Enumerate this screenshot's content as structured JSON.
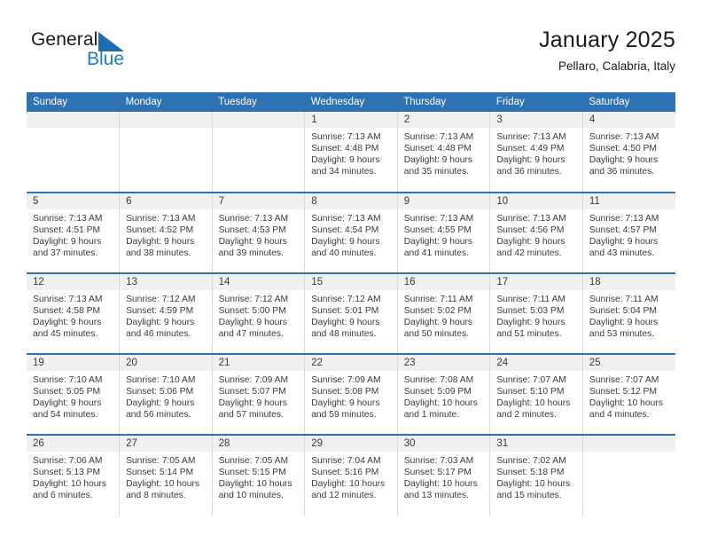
{
  "brand": {
    "name_part1": "General",
    "name_part2": "Blue",
    "logo_icon": "triangle-icon",
    "accent_color": "#1f7bc4",
    "header_color": "#2f72b4"
  },
  "header": {
    "title": "January 2025",
    "location": "Pellaro, Calabria, Italy"
  },
  "weekday_headers": [
    "Sunday",
    "Monday",
    "Tuesday",
    "Wednesday",
    "Thursday",
    "Friday",
    "Saturday"
  ],
  "weeks": [
    [
      {
        "day": "",
        "blank": true
      },
      {
        "day": "",
        "blank": true
      },
      {
        "day": "",
        "blank": true
      },
      {
        "day": "1",
        "sunrise": "Sunrise: 7:13 AM",
        "sunset": "Sunset: 4:48 PM",
        "daylight_line1": "Daylight: 9 hours",
        "daylight_line2": "and 34 minutes."
      },
      {
        "day": "2",
        "sunrise": "Sunrise: 7:13 AM",
        "sunset": "Sunset: 4:48 PM",
        "daylight_line1": "Daylight: 9 hours",
        "daylight_line2": "and 35 minutes."
      },
      {
        "day": "3",
        "sunrise": "Sunrise: 7:13 AM",
        "sunset": "Sunset: 4:49 PM",
        "daylight_line1": "Daylight: 9 hours",
        "daylight_line2": "and 36 minutes."
      },
      {
        "day": "4",
        "sunrise": "Sunrise: 7:13 AM",
        "sunset": "Sunset: 4:50 PM",
        "daylight_line1": "Daylight: 9 hours",
        "daylight_line2": "and 36 minutes."
      }
    ],
    [
      {
        "day": "5",
        "sunrise": "Sunrise: 7:13 AM",
        "sunset": "Sunset: 4:51 PM",
        "daylight_line1": "Daylight: 9 hours",
        "daylight_line2": "and 37 minutes."
      },
      {
        "day": "6",
        "sunrise": "Sunrise: 7:13 AM",
        "sunset": "Sunset: 4:52 PM",
        "daylight_line1": "Daylight: 9 hours",
        "daylight_line2": "and 38 minutes."
      },
      {
        "day": "7",
        "sunrise": "Sunrise: 7:13 AM",
        "sunset": "Sunset: 4:53 PM",
        "daylight_line1": "Daylight: 9 hours",
        "daylight_line2": "and 39 minutes."
      },
      {
        "day": "8",
        "sunrise": "Sunrise: 7:13 AM",
        "sunset": "Sunset: 4:54 PM",
        "daylight_line1": "Daylight: 9 hours",
        "daylight_line2": "and 40 minutes."
      },
      {
        "day": "9",
        "sunrise": "Sunrise: 7:13 AM",
        "sunset": "Sunset: 4:55 PM",
        "daylight_line1": "Daylight: 9 hours",
        "daylight_line2": "and 41 minutes."
      },
      {
        "day": "10",
        "sunrise": "Sunrise: 7:13 AM",
        "sunset": "Sunset: 4:56 PM",
        "daylight_line1": "Daylight: 9 hours",
        "daylight_line2": "and 42 minutes."
      },
      {
        "day": "11",
        "sunrise": "Sunrise: 7:13 AM",
        "sunset": "Sunset: 4:57 PM",
        "daylight_line1": "Daylight: 9 hours",
        "daylight_line2": "and 43 minutes."
      }
    ],
    [
      {
        "day": "12",
        "sunrise": "Sunrise: 7:13 AM",
        "sunset": "Sunset: 4:58 PM",
        "daylight_line1": "Daylight: 9 hours",
        "daylight_line2": "and 45 minutes."
      },
      {
        "day": "13",
        "sunrise": "Sunrise: 7:12 AM",
        "sunset": "Sunset: 4:59 PM",
        "daylight_line1": "Daylight: 9 hours",
        "daylight_line2": "and 46 minutes."
      },
      {
        "day": "14",
        "sunrise": "Sunrise: 7:12 AM",
        "sunset": "Sunset: 5:00 PM",
        "daylight_line1": "Daylight: 9 hours",
        "daylight_line2": "and 47 minutes."
      },
      {
        "day": "15",
        "sunrise": "Sunrise: 7:12 AM",
        "sunset": "Sunset: 5:01 PM",
        "daylight_line1": "Daylight: 9 hours",
        "daylight_line2": "and 48 minutes."
      },
      {
        "day": "16",
        "sunrise": "Sunrise: 7:11 AM",
        "sunset": "Sunset: 5:02 PM",
        "daylight_line1": "Daylight: 9 hours",
        "daylight_line2": "and 50 minutes."
      },
      {
        "day": "17",
        "sunrise": "Sunrise: 7:11 AM",
        "sunset": "Sunset: 5:03 PM",
        "daylight_line1": "Daylight: 9 hours",
        "daylight_line2": "and 51 minutes."
      },
      {
        "day": "18",
        "sunrise": "Sunrise: 7:11 AM",
        "sunset": "Sunset: 5:04 PM",
        "daylight_line1": "Daylight: 9 hours",
        "daylight_line2": "and 53 minutes."
      }
    ],
    [
      {
        "day": "19",
        "sunrise": "Sunrise: 7:10 AM",
        "sunset": "Sunset: 5:05 PM",
        "daylight_line1": "Daylight: 9 hours",
        "daylight_line2": "and 54 minutes."
      },
      {
        "day": "20",
        "sunrise": "Sunrise: 7:10 AM",
        "sunset": "Sunset: 5:06 PM",
        "daylight_line1": "Daylight: 9 hours",
        "daylight_line2": "and 56 minutes."
      },
      {
        "day": "21",
        "sunrise": "Sunrise: 7:09 AM",
        "sunset": "Sunset: 5:07 PM",
        "daylight_line1": "Daylight: 9 hours",
        "daylight_line2": "and 57 minutes."
      },
      {
        "day": "22",
        "sunrise": "Sunrise: 7:09 AM",
        "sunset": "Sunset: 5:08 PM",
        "daylight_line1": "Daylight: 9 hours",
        "daylight_line2": "and 59 minutes."
      },
      {
        "day": "23",
        "sunrise": "Sunrise: 7:08 AM",
        "sunset": "Sunset: 5:09 PM",
        "daylight_line1": "Daylight: 10 hours",
        "daylight_line2": "and 1 minute."
      },
      {
        "day": "24",
        "sunrise": "Sunrise: 7:07 AM",
        "sunset": "Sunset: 5:10 PM",
        "daylight_line1": "Daylight: 10 hours",
        "daylight_line2": "and 2 minutes."
      },
      {
        "day": "25",
        "sunrise": "Sunrise: 7:07 AM",
        "sunset": "Sunset: 5:12 PM",
        "daylight_line1": "Daylight: 10 hours",
        "daylight_line2": "and 4 minutes."
      }
    ],
    [
      {
        "day": "26",
        "sunrise": "Sunrise: 7:06 AM",
        "sunset": "Sunset: 5:13 PM",
        "daylight_line1": "Daylight: 10 hours",
        "daylight_line2": "and 6 minutes."
      },
      {
        "day": "27",
        "sunrise": "Sunrise: 7:05 AM",
        "sunset": "Sunset: 5:14 PM",
        "daylight_line1": "Daylight: 10 hours",
        "daylight_line2": "and 8 minutes."
      },
      {
        "day": "28",
        "sunrise": "Sunrise: 7:05 AM",
        "sunset": "Sunset: 5:15 PM",
        "daylight_line1": "Daylight: 10 hours",
        "daylight_line2": "and 10 minutes."
      },
      {
        "day": "29",
        "sunrise": "Sunrise: 7:04 AM",
        "sunset": "Sunset: 5:16 PM",
        "daylight_line1": "Daylight: 10 hours",
        "daylight_line2": "and 12 minutes."
      },
      {
        "day": "30",
        "sunrise": "Sunrise: 7:03 AM",
        "sunset": "Sunset: 5:17 PM",
        "daylight_line1": "Daylight: 10 hours",
        "daylight_line2": "and 13 minutes."
      },
      {
        "day": "31",
        "sunrise": "Sunrise: 7:02 AM",
        "sunset": "Sunset: 5:18 PM",
        "daylight_line1": "Daylight: 10 hours",
        "daylight_line2": "and 15 minutes."
      },
      {
        "day": "",
        "blank": true
      }
    ]
  ]
}
